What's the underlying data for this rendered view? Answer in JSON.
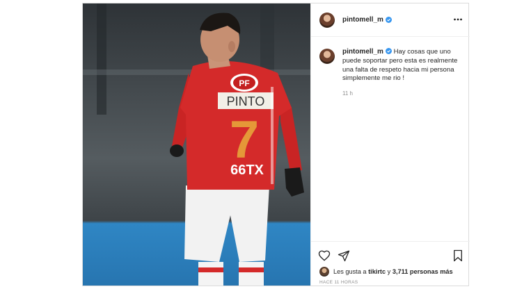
{
  "post": {
    "username": "pintomell_m",
    "caption": "Hay cosas que uno puede soportar pero esta es realmente una falta de respeto hacia mi persona simplemente me rio !",
    "time": "11 h",
    "likes_prefix": "Les gusta a ",
    "likes_user": "tikirtc",
    "likes_mid": " y ",
    "likes_count": "3,711 personas más",
    "posted_ago": "HACE 11 HORAS"
  },
  "photo": {
    "sponsor": "PF",
    "player_name": "PINTO",
    "number": "7",
    "shirt_sponsor": "66TX"
  },
  "icons": {
    "more": "more-options-icon",
    "like": "heart-icon",
    "share": "paper-plane-icon",
    "save": "bookmark-icon",
    "verified": "verified-badge-icon"
  },
  "colors": {
    "jersey": "#d42a2a",
    "verified": "#3897f0",
    "muted": "#8e8e8e"
  }
}
